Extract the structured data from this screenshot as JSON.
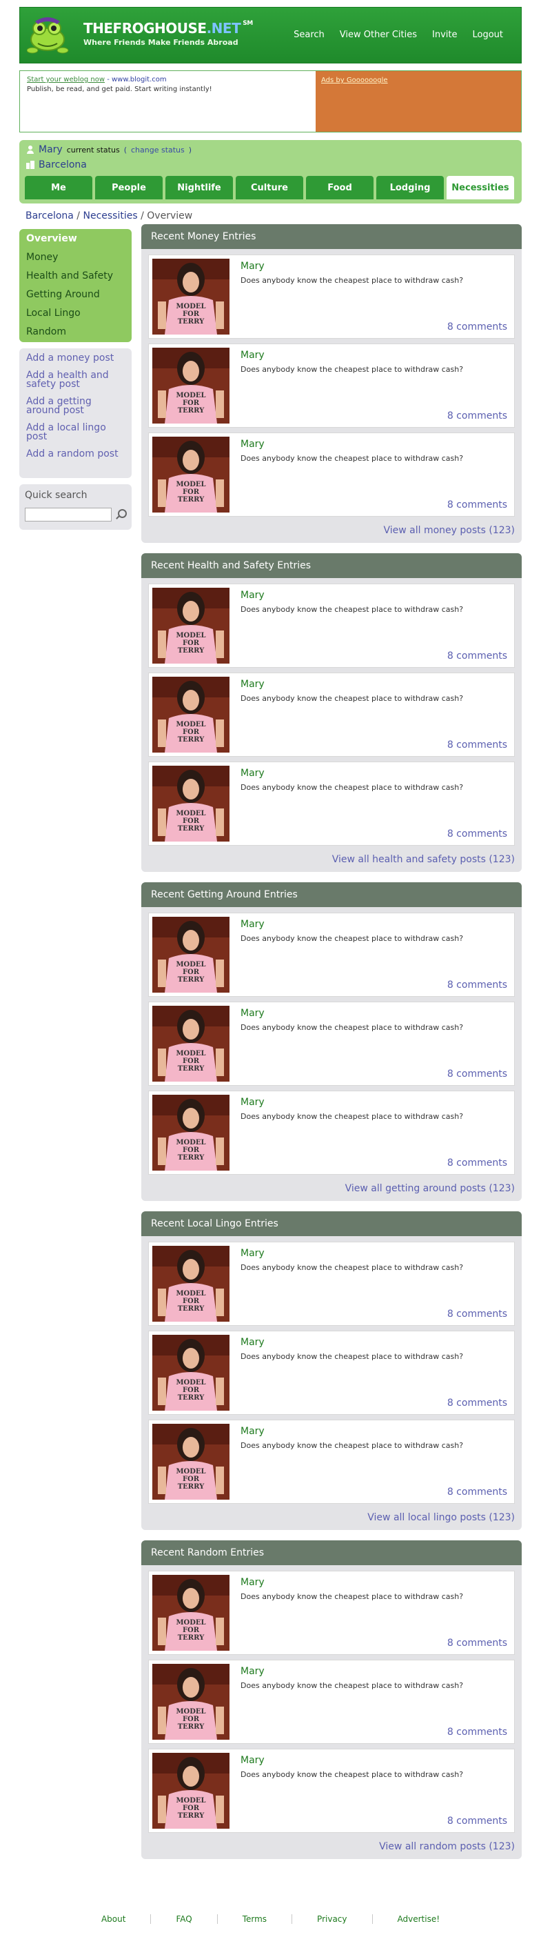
{
  "header": {
    "brand_name": "THEFROGHOUSE",
    "brand_net": ".NET",
    "brand_sm": "SM",
    "tagline": "Where Friends Make Friends Abroad",
    "nav": [
      "Search",
      "View Other Cities",
      "Invite",
      "Logout"
    ]
  },
  "ads": {
    "link_text": "Start your weblog now",
    "url_text": "- www.blogit.com",
    "body": "Publish, be read, and get paid. Start writing instantly!",
    "ads_by": "Ads by Goooooogle"
  },
  "status": {
    "user": "Mary",
    "current_status": "current status",
    "open_paren": "(",
    "change_status": "change status",
    "close_paren": ")",
    "city": "Barcelona"
  },
  "tabs": [
    "Me",
    "People",
    "Nightlife",
    "Culture",
    "Food",
    "Lodging",
    "Necessities"
  ],
  "breadcrumb": {
    "city": "Barcelona",
    "sep1": " / ",
    "section": "Necessities",
    "sep2": " / ",
    "page": "Overview"
  },
  "sidebar": {
    "nav": [
      "Overview",
      "Money",
      "Health and Safety",
      "Getting Around",
      "Local Lingo",
      "Random"
    ],
    "add": [
      "Add a money post",
      "Add a health and safety post",
      "Add a getting around post",
      "Add a local lingo post",
      "Add a random post"
    ],
    "search_label": "Quick search"
  },
  "sections": [
    {
      "title": "Recent Money Entries",
      "view_all": "View all money posts (123)",
      "entries": [
        {
          "author": "Mary",
          "text": "Does anybody know the cheapest place to withdraw cash?",
          "comments": "8 comments"
        },
        {
          "author": "Mary",
          "text": "Does anybody know the cheapest place to withdraw cash?",
          "comments": "8 comments"
        },
        {
          "author": "Mary",
          "text": "Does anybody know the cheapest place to withdraw cash?",
          "comments": "8 comments"
        }
      ]
    },
    {
      "title": "Recent Health and Safety Entries",
      "view_all": "View all health and safety posts (123)",
      "entries": [
        {
          "author": "Mary",
          "text": "Does anybody know the cheapest place to withdraw cash?",
          "comments": "8 comments"
        },
        {
          "author": "Mary",
          "text": "Does anybody know the cheapest place to withdraw cash?",
          "comments": "8 comments"
        },
        {
          "author": "Mary",
          "text": "Does anybody know the cheapest place to withdraw cash?",
          "comments": "8 comments"
        }
      ]
    },
    {
      "title": "Recent Getting Around Entries",
      "view_all": "View all getting around posts (123)",
      "entries": [
        {
          "author": "Mary",
          "text": "Does anybody know the cheapest place to withdraw cash?",
          "comments": "8 comments"
        },
        {
          "author": "Mary",
          "text": "Does anybody know the cheapest place to withdraw cash?",
          "comments": "8 comments"
        },
        {
          "author": "Mary",
          "text": "Does anybody know the cheapest place to withdraw cash?",
          "comments": "8 comments"
        }
      ]
    },
    {
      "title": "Recent Local Lingo Entries",
      "view_all": "View all local lingo posts (123)",
      "entries": [
        {
          "author": "Mary",
          "text": "Does anybody know the cheapest place to withdraw cash?",
          "comments": "8 comments"
        },
        {
          "author": "Mary",
          "text": "Does anybody know the cheapest place to withdraw cash?",
          "comments": "8 comments"
        },
        {
          "author": "Mary",
          "text": "Does anybody know the cheapest place to withdraw cash?",
          "comments": "8 comments"
        }
      ]
    },
    {
      "title": "Recent Random Entries",
      "view_all": "View all random posts (123)",
      "entries": [
        {
          "author": "Mary",
          "text": "Does anybody know the cheapest place to withdraw cash?",
          "comments": "8 comments"
        },
        {
          "author": "Mary",
          "text": "Does anybody know the cheapest place to withdraw cash?",
          "comments": "8 comments"
        },
        {
          "author": "Mary",
          "text": "Does anybody know the cheapest place to withdraw cash?",
          "comments": "8 comments"
        }
      ]
    }
  ],
  "thumb_text": [
    "MODEL",
    "FOR",
    "TERRY"
  ],
  "footer": [
    "About",
    "FAQ",
    "Terms",
    "Privacy",
    "Advertise!"
  ]
}
